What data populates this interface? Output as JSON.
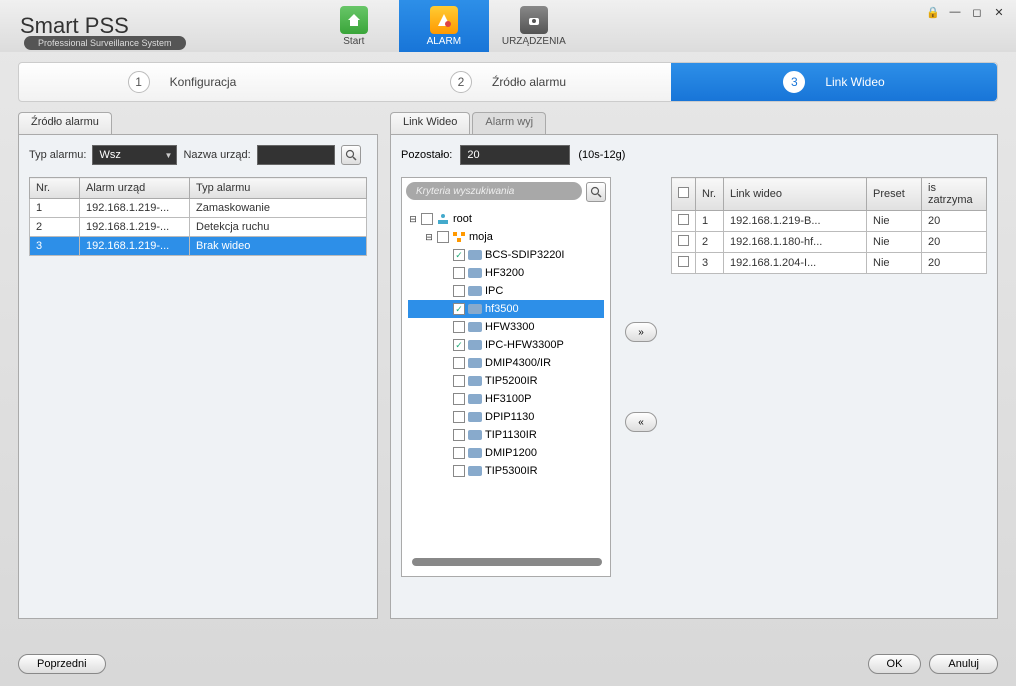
{
  "app": {
    "title": "Smart PSS",
    "subtitle": "Professional Surveillance System"
  },
  "nav": {
    "start": "Start",
    "alarm": "ALARM",
    "devices": "URZĄDZENIA"
  },
  "wizard": {
    "step1": "Konfiguracja",
    "step2": "Źródło alarmu",
    "step3": "Link Wideo"
  },
  "left": {
    "tab": "Źródło alarmu",
    "type_label": "Typ alarmu:",
    "type_value": "Wsz",
    "name_label": "Nazwa urząd:",
    "name_value": "",
    "cols": {
      "nr": "Nr.",
      "dev": "Alarm urząd",
      "type": "Typ alarmu"
    },
    "rows": [
      {
        "nr": "1",
        "dev": "192.168.1.219-...",
        "type": "Zamaskowanie"
      },
      {
        "nr": "2",
        "dev": "192.168.1.219-...",
        "type": "Detekcja ruchu"
      },
      {
        "nr": "3",
        "dev": "192.168.1.219-...",
        "type": "Brak wideo"
      }
    ]
  },
  "right": {
    "tab1": "Link Wideo",
    "tab2": "Alarm wyj",
    "remain_label": "Pozostało:",
    "remain_value": "20",
    "remain_hint": "(10s-12g)",
    "search_placeholder": "Kryteria wyszukiwania",
    "tree": {
      "root": "root",
      "group": "moja",
      "items": [
        {
          "label": "BCS-SDIP3220I",
          "checked": true
        },
        {
          "label": "HF3200",
          "checked": false
        },
        {
          "label": "IPC",
          "checked": false
        },
        {
          "label": "hf3500",
          "checked": true,
          "selected": true
        },
        {
          "label": "HFW3300",
          "checked": false
        },
        {
          "label": "IPC-HFW3300P",
          "checked": true
        },
        {
          "label": "DMIP4300/IR",
          "checked": false
        },
        {
          "label": "TIP5200IR",
          "checked": false
        },
        {
          "label": "HF3100P",
          "checked": false
        },
        {
          "label": "DPIP1130",
          "checked": false
        },
        {
          "label": "TIP1130IR",
          "checked": false
        },
        {
          "label": "DMIP1200",
          "checked": false
        },
        {
          "label": "TIP5300IR",
          "checked": false
        }
      ]
    },
    "link_cols": {
      "nr": "Nr.",
      "link": "Link wideo",
      "preset": "Preset",
      "stay": "is zatrzyma"
    },
    "link_rows": [
      {
        "nr": "1",
        "link": "192.168.1.219-B...",
        "preset": "Nie",
        "stay": "20"
      },
      {
        "nr": "2",
        "link": "192.168.1.180-hf...",
        "preset": "Nie",
        "stay": "20"
      },
      {
        "nr": "3",
        "link": "192.168.1.204-I...",
        "preset": "Nie",
        "stay": "20"
      }
    ]
  },
  "buttons": {
    "add": "»",
    "remove": "«",
    "prev": "Poprzedni",
    "ok": "OK",
    "cancel": "Anuluj"
  }
}
